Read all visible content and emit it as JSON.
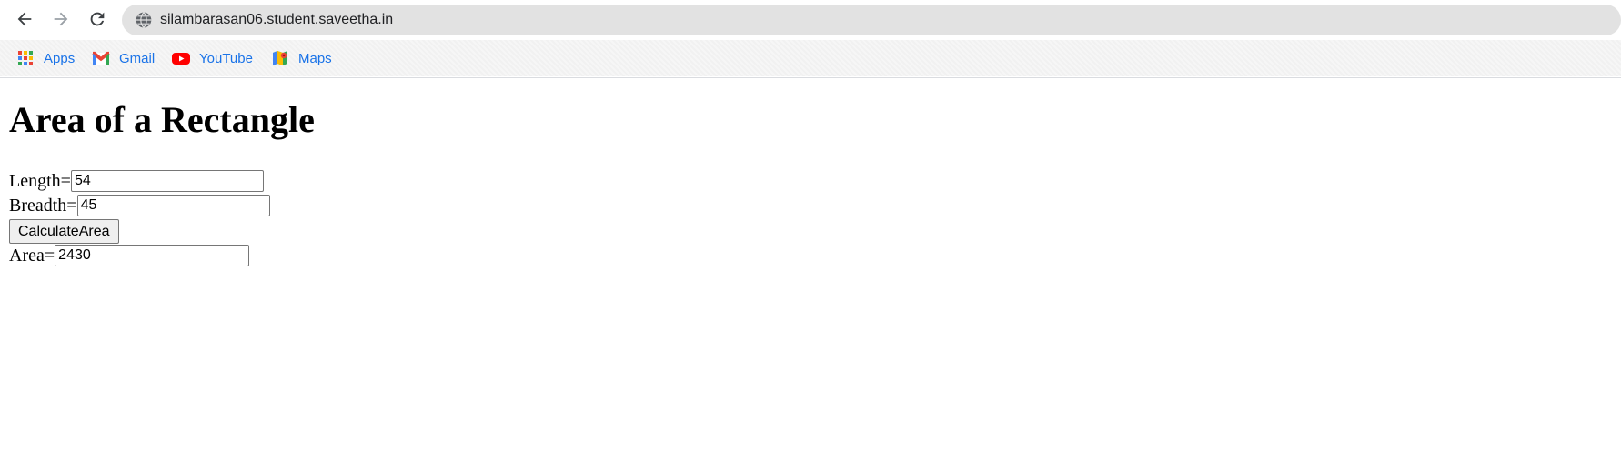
{
  "browser": {
    "back_icon": "arrow-left-icon",
    "forward_icon": "arrow-right-icon",
    "reload_icon": "reload-icon",
    "site_info_icon": "globe-icon",
    "url": "silambarasan06.student.saveetha.in"
  },
  "bookmarks": [
    {
      "label": "Apps",
      "icon": "apps-grid-icon"
    },
    {
      "label": "Gmail",
      "icon": "gmail-icon"
    },
    {
      "label": "YouTube",
      "icon": "youtube-icon"
    },
    {
      "label": "Maps",
      "icon": "maps-icon"
    }
  ],
  "page": {
    "title": "Area of a Rectangle",
    "length_label": "Length=",
    "length_value": "54",
    "breadth_label": "Breadth=",
    "breadth_value": "45",
    "button_label": "CalculateArea",
    "area_label": "Area=",
    "area_value": "2430"
  }
}
